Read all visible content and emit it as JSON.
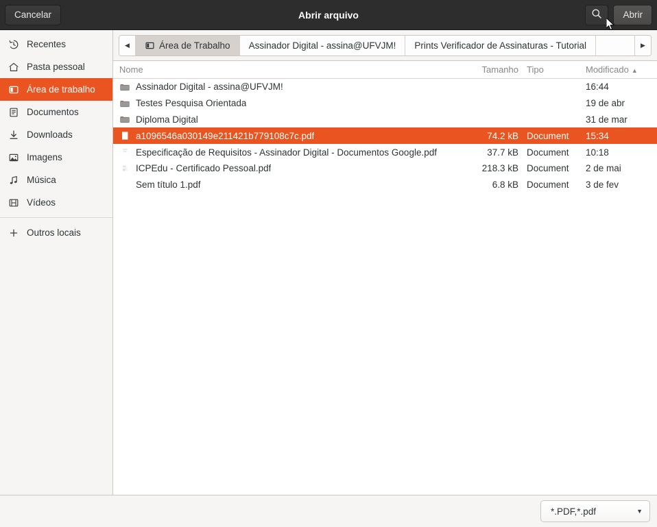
{
  "header": {
    "title": "Abrir arquivo",
    "cancel_label": "Cancelar",
    "open_label": "Abrir",
    "search_icon": "search-icon",
    "accent_color": "#e95420",
    "background_color": "#2d2d2d"
  },
  "sidebar": {
    "items": [
      {
        "label": "Recentes",
        "icon": "clock-icon",
        "active": false
      },
      {
        "label": "Pasta pessoal",
        "icon": "home-icon",
        "active": false
      },
      {
        "label": "Área de trabalho",
        "icon": "desktop-icon",
        "active": true
      },
      {
        "label": "Documentos",
        "icon": "document-icon",
        "active": false
      },
      {
        "label": "Downloads",
        "icon": "download-icon",
        "active": false
      },
      {
        "label": "Imagens",
        "icon": "image-icon",
        "active": false
      },
      {
        "label": "Música",
        "icon": "music-icon",
        "active": false
      },
      {
        "label": "Vídeos",
        "icon": "video-icon",
        "active": false
      }
    ],
    "other_locations": {
      "label": "Outros locais",
      "icon": "plus-icon"
    }
  },
  "pathbar": {
    "back_icon": "chevron-left-icon",
    "forward_icon": "chevron-right-icon",
    "crumbs": [
      {
        "label": "Área de Trabalho",
        "icon": "desktop-icon",
        "current": true
      },
      {
        "label": "Assinador Digital - assina@UFVJM!",
        "current": false
      },
      {
        "label": "Prints Verificador de Assinaturas - Tutorial",
        "current": false
      }
    ]
  },
  "list": {
    "columns": {
      "name": "Nome",
      "size": "Tamanho",
      "type": "Tipo",
      "modified": "Modificado",
      "sort_indicator": "▲"
    },
    "rows": [
      {
        "name": "Assinador Digital - assina@UFVJM!",
        "size": "",
        "type": "",
        "modified": "16:44",
        "icon": "folder-icon",
        "selected": false
      },
      {
        "name": "Testes Pesquisa Orientada",
        "size": "",
        "type": "",
        "modified": "19 de abr",
        "icon": "folder-icon",
        "selected": false
      },
      {
        "name": "Diploma Digital",
        "size": "",
        "type": "",
        "modified": "31 de mar",
        "icon": "folder-icon",
        "selected": false
      },
      {
        "name": "a1096546a030149e211421b779108c7c.pdf",
        "size": "74.2 kB",
        "type": "Document",
        "modified": "15:34",
        "icon": "pdf-blank-icon",
        "selected": true
      },
      {
        "name": "Especificação de Requisitos - Assinador Digital - Documentos Google.pdf",
        "size": "37.7 kB",
        "type": "Document",
        "modified": "10:18",
        "icon": "pdf-thumb-icon",
        "selected": false
      },
      {
        "name": "ICPEdu - Certificado Pessoal.pdf",
        "size": "218.3 kB",
        "type": "Document",
        "modified": "2 de mai",
        "icon": "pdf-thumb-icon",
        "selected": false
      },
      {
        "name": "Sem título 1.pdf",
        "size": "6.8 kB",
        "type": "Document",
        "modified": "3 de fev",
        "icon": "pdf-empty-icon",
        "selected": false
      }
    ]
  },
  "footer": {
    "filter_value": "*.PDF,*.pdf",
    "chevron_icon": "chevron-down-icon"
  }
}
